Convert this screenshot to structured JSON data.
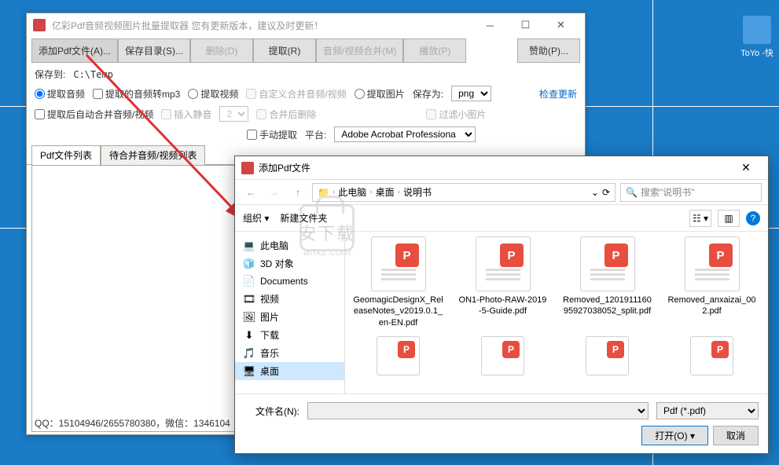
{
  "desktop": {
    "icon_label": "ToYo\n-快"
  },
  "main": {
    "title": "亿彩Pdf音频视频图片批量提取器   您有更新版本，建议及时更新！",
    "toolbar": {
      "add": "添加Pdf文件(A)...",
      "save_dir": "保存目录(S)...",
      "delete": "删除(D)",
      "extract": "提取(R)",
      "merge": "音频/视频合并(M)",
      "play": "播放(P)",
      "sponsor": "赞助(P)..."
    },
    "opts": {
      "save_to_lbl": "保存到:",
      "save_to": "C:\\Temp",
      "extract_audio": "提取音频",
      "audio_mp3": "提取的音频转mp3",
      "extract_video": "提取视频",
      "custom_merge": "自定义合并音频/视频",
      "extract_img": "提取图片",
      "save_as": "保存为:",
      "format": "png",
      "auto_merge": "提取后自动合并音频/视频",
      "insert_silence": "插入静音",
      "silence_sec": "2",
      "delete_after_merge": "合并后删除",
      "filter_small": "过滤小图片",
      "manual_extract": "手动提取",
      "platform_lbl": "平台:",
      "platform": "Adobe Acrobat Professiona",
      "check_update": "检查更新"
    },
    "tabs": {
      "list": "Pdf文件列表",
      "pending": "待合并音频/视频列表"
    },
    "status": "QQ：15104946/2655780380，微信：1346104"
  },
  "dialog": {
    "title": "添加Pdf文件",
    "crumbs": [
      "此电脑",
      "桌面",
      "说明书"
    ],
    "search_placeholder": "搜索\"说明书\"",
    "organize": "组织",
    "new_folder": "新建文件夹",
    "sidebar": [
      {
        "icon": "💻",
        "label": "此电脑"
      },
      {
        "icon": "🧊",
        "label": "3D 对象"
      },
      {
        "icon": "📄",
        "label": "Documents"
      },
      {
        "icon": "🎞",
        "label": "视频"
      },
      {
        "icon": "🖼",
        "label": "图片"
      },
      {
        "icon": "⬇",
        "label": "下载"
      },
      {
        "icon": "🎵",
        "label": "音乐"
      },
      {
        "icon": "🖥",
        "label": "桌面",
        "selected": true
      }
    ],
    "files": [
      "GeomagicDesignX_ReleaseNotes_v2019.0.1_en-EN.pdf",
      "ON1-Photo-RAW-2019-5-Guide.pdf",
      "Removed_120191116095927038052_split.pdf",
      "Removed_anxaizai_002.pdf"
    ],
    "filename_lbl": "文件名(N):",
    "filter": "Pdf (*.pdf)",
    "open": "打开(O)",
    "cancel": "取消"
  },
  "watermark": {
    "cn": "安下载",
    "url": "anxz.com"
  }
}
